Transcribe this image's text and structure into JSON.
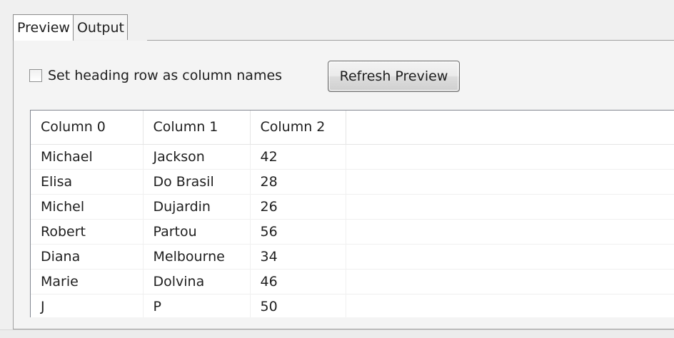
{
  "tabs": [
    {
      "label": "Preview",
      "active": true
    },
    {
      "label": "Output",
      "active": false
    }
  ],
  "options": {
    "heading_checkbox_label": "Set heading row as column names",
    "heading_checkbox_checked": false,
    "refresh_button_label": "Refresh Preview"
  },
  "table": {
    "columns": [
      "Column 0",
      "Column 1",
      "Column 2"
    ],
    "rows": [
      [
        "Michael",
        "Jackson",
        "42"
      ],
      [
        "Elisa",
        "Do Brasil",
        "28"
      ],
      [
        "Michel",
        "Dujardin",
        "26"
      ],
      [
        "Robert",
        "Partou",
        "56"
      ],
      [
        "Diana",
        "Melbourne",
        "34"
      ],
      [
        "Marie",
        "Dolvina",
        "46"
      ],
      [
        "J",
        "P",
        "50"
      ]
    ]
  }
}
